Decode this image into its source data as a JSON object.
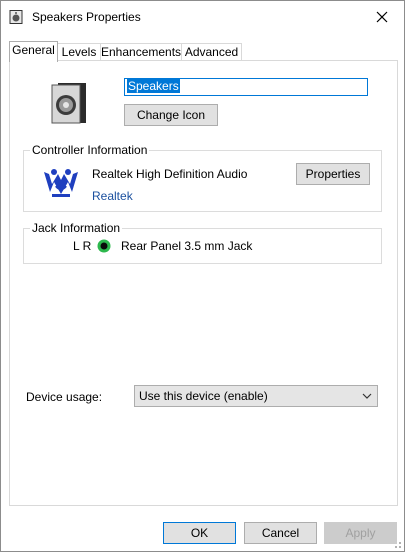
{
  "window": {
    "title": "Speakers Properties"
  },
  "tabs": [
    {
      "label": "General"
    },
    {
      "label": "Levels"
    },
    {
      "label": "Enhancements"
    },
    {
      "label": "Advanced"
    }
  ],
  "general": {
    "device_name": "Speakers",
    "change_icon_label": "Change Icon",
    "controller": {
      "title": "Controller Information",
      "name": "Realtek High Definition Audio",
      "vendor": "Realtek",
      "properties_label": "Properties"
    },
    "jack": {
      "title": "Jack Information",
      "channels": "L R",
      "description": "Rear Panel 3.5 mm Jack",
      "color": "#2db84d"
    },
    "usage": {
      "label": "Device usage:",
      "selected": "Use this device (enable)"
    }
  },
  "footer": {
    "ok": "OK",
    "cancel": "Cancel",
    "apply": "Apply"
  },
  "colors": {
    "accent": "#0078d7",
    "link": "#1a4f9e"
  },
  "icons": [
    "speaker-small-icon",
    "close-icon",
    "speaker-icon",
    "realtek-logo",
    "jack-green-icon",
    "chevron-down-icon",
    "resize-grip-icon"
  ]
}
